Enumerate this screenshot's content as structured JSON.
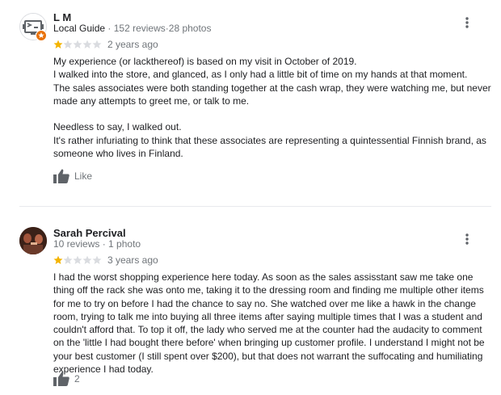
{
  "reviews": [
    {
      "name": "L M",
      "local_guide_label": "Local Guide",
      "separator": "·",
      "reviews_count": "152 reviews",
      "photos_count": "28 photos",
      "rating": 1,
      "rating_max": 5,
      "date": "2 years ago",
      "text": "My experience (or lackthereof) is based on my visit in October of 2019.\nI walked into the store, and glanced, as I only had a little bit of time on my hands at that moment.\nThe sales associates were both standing together at the cash wrap, they were watching me, but never made any attempts to greet me, or talk to me.\n\nNeedless to say, I walked out.\nIt's rather infuriating to think that these associates are representing a quintessential Finnish brand, as someone who lives in Finland.",
      "like_label": "Like"
    },
    {
      "name": "Sarah Percival",
      "separator": "·",
      "reviews_count": "10 reviews",
      "photos_count": "1 photo",
      "rating": 1,
      "rating_max": 5,
      "date": "3 years ago",
      "text": "I had the worst shopping experience here today. As soon as the sales assisstant saw me take one thing off the rack she was onto me, taking it to the dressing room and finding me multiple other items for me to try on before I had the chance to say no. She watched over me like a hawk in the change room, trying to talk me into buying all three items after saying multiple times that I was a student and couldn't afford that.  To top it off, the lady who served me at the counter had the audacity to comment on the 'little I had bought there before' when bringing up customer profile. I understand I might not be your best customer (I still spent over $200), but that does not warrant the suffocating and humiliating experience I had today.",
      "like_count": "2"
    }
  ],
  "colors": {
    "star_filled": "#f4b400",
    "star_empty": "#dadce0",
    "local_guide_badge": "#e8710a",
    "secondary_text": "#70757a"
  },
  "icons": [
    "robot-avatar-icon",
    "local-guide-badge-icon",
    "more-options-icon",
    "thumbs-up-icon",
    "star-icon"
  ]
}
